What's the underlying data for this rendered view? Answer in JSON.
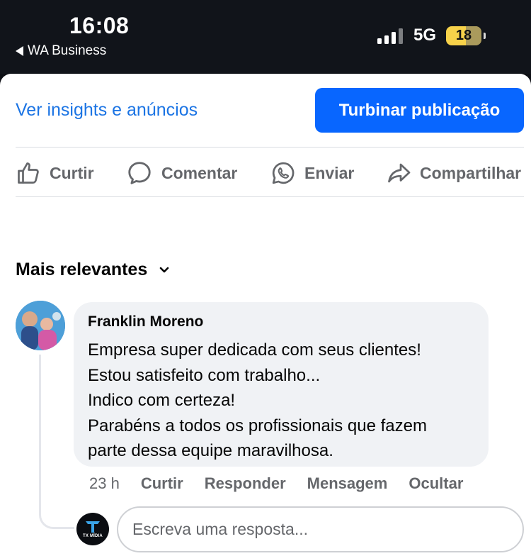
{
  "status_bar": {
    "time": "16:08",
    "back_app": "WA Business",
    "network": "5G",
    "battery": "18",
    "icons": [
      "back-arrow-icon",
      "signal-icon",
      "battery-icon"
    ]
  },
  "post_actions": {
    "insights_link": "Ver insights e anúncios",
    "boost_button": "Turbinar publicação",
    "like": "Curtir",
    "comment": "Comentar",
    "send": "Enviar",
    "share": "Compartilhar",
    "icons": [
      "thumbs-up-icon",
      "comment-bubble-icon",
      "whatsapp-icon",
      "share-arrow-icon"
    ]
  },
  "comments": {
    "sort_label": "Mais relevantes",
    "sort_icon": "chevron-down-icon",
    "items": [
      {
        "author": "Franklin Moreno",
        "lines": [
          "Empresa super dedicada com seus clientes!",
          "Estou satisfeito com trabalho...",
          "Indico com certeza!",
          "Parabéns a todos os profissionais que fazem",
          "parte dessa equipe maravilhosa."
        ],
        "age": "23 h",
        "actions": [
          "Curtir",
          "Responder",
          "Mensagem",
          "Ocultar"
        ]
      }
    ]
  },
  "reply_box": {
    "placeholder": "Escreva uma resposta...",
    "avatar_text": "TX MÍDIA"
  },
  "colors": {
    "accent": "#0866ff",
    "link": "#1b74e4",
    "secondary_text": "#65676b",
    "bubble": "#f0f2f5"
  }
}
